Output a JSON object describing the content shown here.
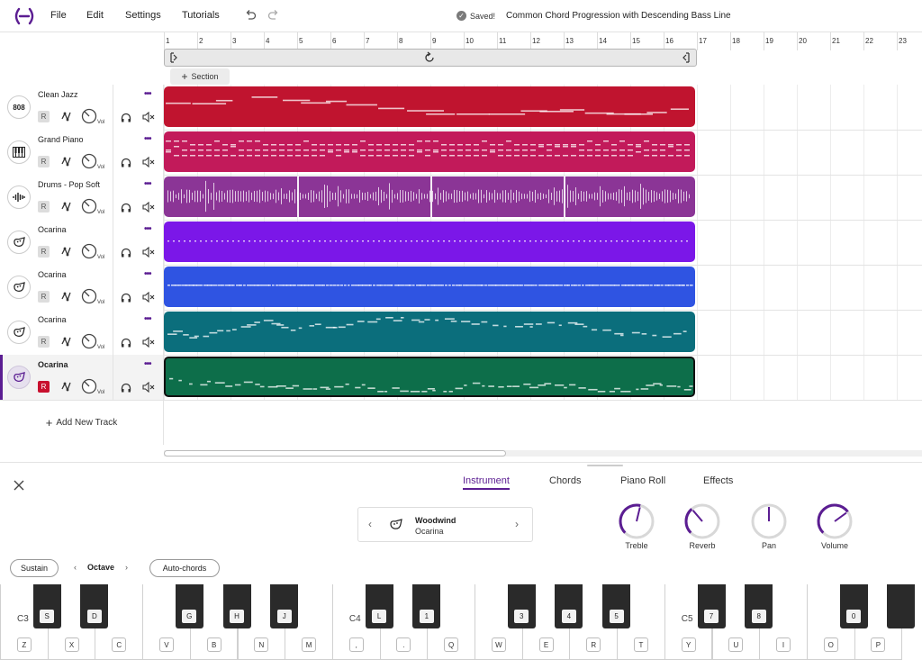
{
  "menu": {
    "file": "File",
    "edit": "Edit",
    "settings": "Settings",
    "tutorials": "Tutorials"
  },
  "status": {
    "saved": "Saved!",
    "title": "Common Chord Progression with Descending Bass Line"
  },
  "ruler": [
    "1",
    "2",
    "3",
    "4",
    "5",
    "6",
    "7",
    "8",
    "9",
    "10",
    "11",
    "12",
    "13",
    "14",
    "15",
    "16",
    "17",
    "18",
    "19",
    "20",
    "21",
    "22",
    "23"
  ],
  "section_button": "Section",
  "tracks": [
    {
      "name": "Clean Jazz",
      "icon_text": "808",
      "icon": "drum-machine-icon",
      "rec": "R",
      "vol": "Vol",
      "color": "#c0142f",
      "selected": false
    },
    {
      "name": "Grand Piano",
      "icon_text": "",
      "icon": "piano-icon",
      "rec": "R",
      "vol": "Vol",
      "color": "#c21a5a",
      "selected": false
    },
    {
      "name": "Drums - Pop Soft",
      "icon_text": "",
      "icon": "waveform-icon",
      "rec": "R",
      "vol": "Vol",
      "color": "#8b3596",
      "selected": false
    },
    {
      "name": "Ocarina",
      "icon_text": "",
      "icon": "ocarina-icon",
      "rec": "R",
      "vol": "Vol",
      "color": "#7b17e8",
      "selected": false
    },
    {
      "name": "Ocarina",
      "icon_text": "",
      "icon": "ocarina-icon",
      "rec": "R",
      "vol": "Vol",
      "color": "#2f54e2",
      "selected": false
    },
    {
      "name": "Ocarina",
      "icon_text": "",
      "icon": "ocarina-icon",
      "rec": "R",
      "vol": "Vol",
      "color": "#0b6e7c",
      "selected": false
    },
    {
      "name": "Ocarina",
      "icon_text": "",
      "icon": "ocarina-icon",
      "rec": "R",
      "vol": "Vol",
      "color": "#0d6e4a",
      "selected": true
    }
  ],
  "add_track": "Add New Track",
  "panel": {
    "tabs": [
      "Instrument",
      "Chords",
      "Piano Roll",
      "Effects"
    ],
    "active_tab": "Instrument",
    "instrument_category": "Woodwind",
    "instrument_name": "Ocarina",
    "knobs": [
      {
        "label": "Treble",
        "level": 0.55
      },
      {
        "label": "Reverb",
        "level": 0.35
      },
      {
        "label": "Pan",
        "level": 0.5
      },
      {
        "label": "Volume",
        "level": 0.7
      }
    ],
    "sustain": "Sustain",
    "octave": "Octave",
    "auto_chords": "Auto-chords"
  },
  "keyboard": {
    "white_keys": [
      "Z",
      "X",
      "C",
      "V",
      "B",
      "N",
      "M",
      ",",
      ".",
      "Q",
      "W",
      "E",
      "R",
      "T",
      "Y",
      "U",
      "I",
      "O",
      "P"
    ],
    "black_keys": [
      "S",
      "D",
      "G",
      "H",
      "J",
      "L",
      "1",
      "3",
      "4",
      "5",
      "7",
      "8",
      "0",
      ""
    ],
    "octave_labels": [
      "C3",
      "C4",
      "C5"
    ]
  },
  "colors": {
    "accent": "#5b1d92",
    "record": "#c8102e"
  }
}
